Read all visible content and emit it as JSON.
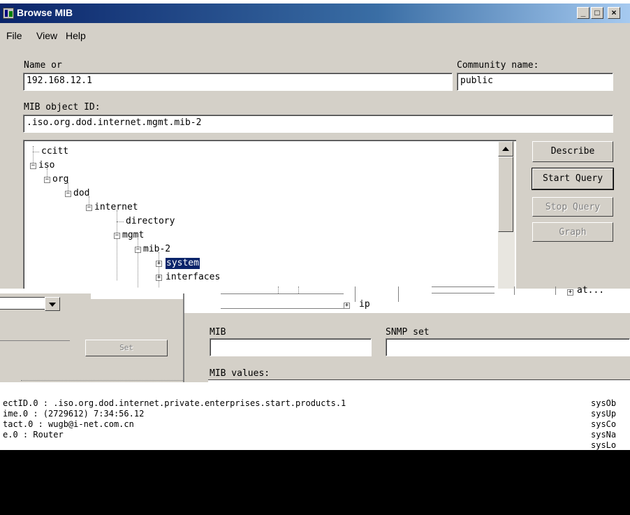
{
  "window": {
    "title": "Browse MIB"
  },
  "menu": [
    {
      "label": "File"
    },
    {
      "label": "View"
    },
    {
      "label": "Help"
    }
  ],
  "form": {
    "name_label": "Name or",
    "name_value": "192.168.12.1",
    "community_label": "Community name:",
    "community_value": "public",
    "oid_label": "MIB object ID:",
    "oid_value": ".iso.org.dod.internet.mgmt.mib-2"
  },
  "tree": {
    "nodes": [
      {
        "label": "ccitt"
      },
      {
        "label": "iso"
      },
      {
        "label": "org"
      },
      {
        "label": "dod"
      },
      {
        "label": "internet"
      },
      {
        "label": "directory"
      },
      {
        "label": "mgmt"
      },
      {
        "label": "mib-2"
      },
      {
        "label": "system"
      },
      {
        "label": "interfaces"
      },
      {
        "label": "at..."
      },
      {
        "label": "ip"
      }
    ]
  },
  "buttons": {
    "describe": "Describe",
    "start_query": "Start Query",
    "stop_query": "Stop Query",
    "graph": "Graph"
  },
  "lower": {
    "mib_label": "MIB",
    "snmp_set_label": "SNMP set",
    "mib_values_label": "MIB values:",
    "disabled_button": "Set"
  },
  "output": {
    "lines": [
      "ectID.0 : .iso.org.dod.internet.private.enterprises.start.products.1",
      "ime.0 : (2729612) 7:34:56.12",
      "tact.0 : wugb@i-net.com.cn",
      "e.0 : Router"
    ],
    "right_lines": [
      "sysOb",
      "sysUp",
      "sysCo",
      "sysNa",
      "sysLo"
    ]
  }
}
